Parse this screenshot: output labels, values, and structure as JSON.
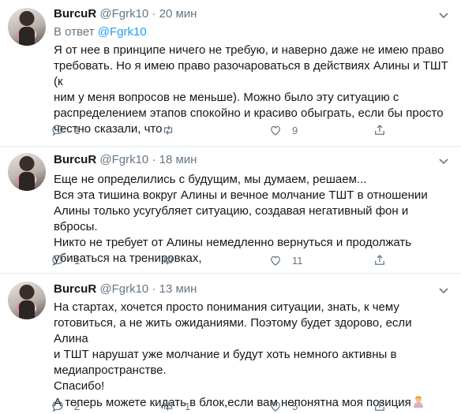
{
  "tweets": [
    {
      "name": "BurcuR",
      "handle": "@Fgrk10",
      "time": "20 мин",
      "reply_prefix": "В ответ",
      "reply_handle": "@Fgrk10",
      "lines": [
        "Я от нее в принципе ничего не требую, и наверно даже не имею право",
        "требовать. Но я имею право разочароваться в действиях Алины и ТШТ (к",
        "ним у меня вопросов не меньше). Можно было эту ситуацию с",
        "распределением этапов спокойно и красиво обыграть, если бы просто",
        "честно сказали, что"
      ],
      "reply_count": "1",
      "retweet_count": "",
      "like_count": "9"
    },
    {
      "name": "BurcuR",
      "handle": "@Fgrk10",
      "time": "18 мин",
      "lines": [
        "Еще не определились с будущим, мы думаем, решаем...",
        "Вся эта тишина вокруг Алины и вечное молчание ТШТ в отношении",
        "Алины только усугубляет ситуацию, создавая негативный фон и вбросы.",
        "Никто не требует от Алины немедленно вернуться и продолжать",
        "убиваться на тренировках,"
      ],
      "reply_count": "1",
      "retweet_count": "",
      "like_count": "11"
    },
    {
      "name": "BurcuR",
      "handle": "@Fgrk10",
      "time": "13 мин",
      "lines": [
        "На стартах, хочется просто понимания ситуации, знать, к чему",
        "готовиться, а не жить ожиданиями. Поэтому будет здорово, если Алина",
        "и ТШТ нарушат уже молчание и будут хоть немного активны в",
        "медиапространстве.",
        "Спасибо!",
        "А теперь можете кидать в блок,если вам непонятна моя позиция"
      ],
      "emoji": "person-gesturing-no",
      "reply_count": "2",
      "retweet_count": "1",
      "like_count": "5"
    }
  ],
  "colors": {
    "text": "#14171a",
    "muted": "#657786",
    "link": "#1da1f2",
    "divider": "#e6ecf0"
  }
}
